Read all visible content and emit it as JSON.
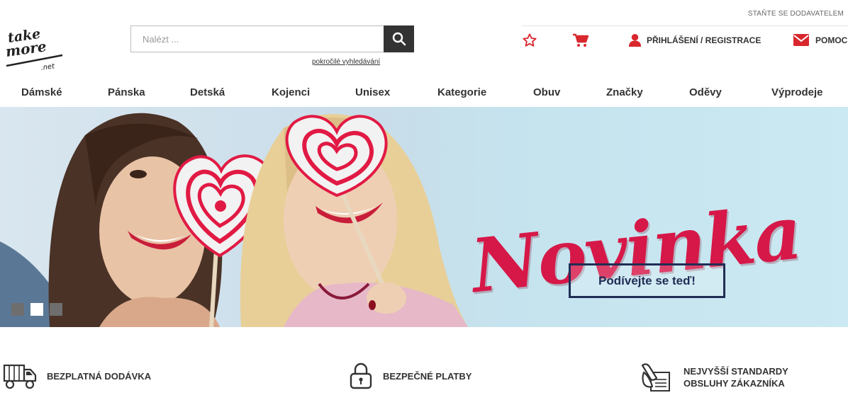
{
  "header": {
    "supplier_link": "STAŇTE SE DODAVATELEM",
    "logo_text": [
      "take",
      "more",
      ".net"
    ],
    "search": {
      "placeholder": "Nalézt ...",
      "advanced_link": "pokročilé vyhledávání"
    },
    "actions": {
      "favorites_icon": "star-icon",
      "cart_icon": "cart-icon",
      "login_label": "PŘIHLÁŠENÍ / REGISTRACE",
      "help_label": "POMOC"
    }
  },
  "nav": {
    "items": [
      "Dámské",
      "Pánska",
      "Detská",
      "Kojenci",
      "Unisex",
      "Kategorie",
      "Obuv",
      "Značky",
      "Oděvy",
      "Výprodeje"
    ]
  },
  "hero": {
    "title": "Novinka",
    "cta_label": "Podívejte se teď!",
    "slide_count": 3,
    "active_slide": 2
  },
  "benefits": [
    {
      "icon": "truck-icon",
      "label": "BEZPLATNÁ DODÁVKA"
    },
    {
      "icon": "lock-icon",
      "label": "BEZPEČNÉ PLATBY"
    },
    {
      "icon": "contract-icon",
      "label": "NEJVYŠŠÍ STANDARDY OBSLUHY ZÁKAZNÍKA"
    }
  ],
  "colors": {
    "accent_red": "#d9272e",
    "hero_title": "#d61848",
    "cta_border": "#1f2d55",
    "search_button": "#333333"
  }
}
